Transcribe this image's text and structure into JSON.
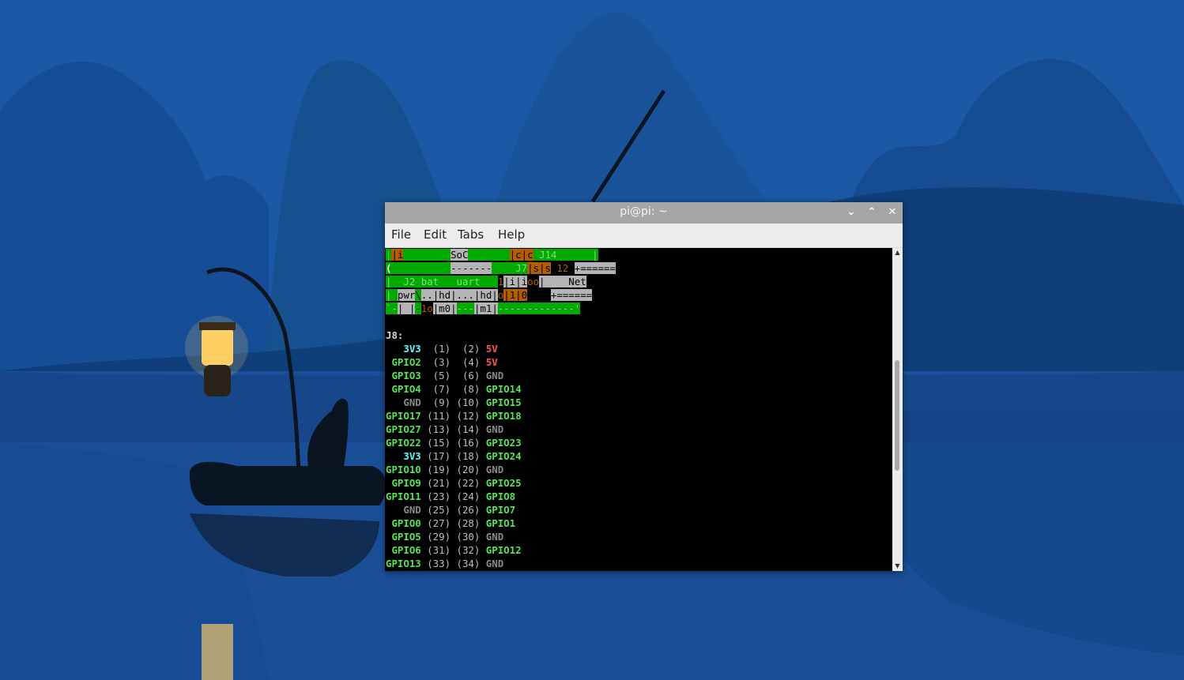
{
  "window": {
    "title": "pi@pi: ~",
    "buttons": {
      "minimize": "⌄",
      "maximize": "⌃",
      "close": "✕"
    }
  },
  "menu": {
    "file": "File",
    "edit": "Edit",
    "tabs": "Tabs",
    "help": "Help"
  },
  "board_art": {
    "line1": [
      "|",
      "|i",
      "        ",
      "SoC",
      "       ",
      "|c|c",
      " J14      |"
    ],
    "line2": [
      "(",
      "          ",
      "-------",
      "    J7",
      "|s|s",
      " 12 ",
      "+======"
    ],
    "line3": [
      "|  J2 bat   uart   ",
      "1",
      "|i|i",
      "oo",
      "|    Net"
    ],
    "line4": [
      "| ",
      "pwr",
      "\\",
      "..|hd|...|hd|",
      "o",
      "|1|0",
      "    ",
      "+======"
    ],
    "line5": [
      "`-",
      "| |",
      "-",
      "1o",
      "|m0|",
      "---",
      "|m1|",
      "-------------'"
    ]
  },
  "header_label": "J8:",
  "pins": [
    {
      "left": "3V3",
      "left_type": "3v3",
      "a": "(1)",
      "b": "(2)",
      "right": "5V",
      "right_type": "5v"
    },
    {
      "left": "GPIO2",
      "left_type": "gpio",
      "a": "(3)",
      "b": "(4)",
      "right": "5V",
      "right_type": "5v"
    },
    {
      "left": "GPIO3",
      "left_type": "gpio",
      "a": "(5)",
      "b": "(6)",
      "right": "GND",
      "right_type": "gnd"
    },
    {
      "left": "GPIO4",
      "left_type": "gpio",
      "a": "(7)",
      "b": "(8)",
      "right": "GPIO14",
      "right_type": "gpio"
    },
    {
      "left": "GND",
      "left_type": "gnd",
      "a": "(9)",
      "b": "(10)",
      "right": "GPIO15",
      "right_type": "gpio"
    },
    {
      "left": "GPIO17",
      "left_type": "gpio",
      "a": "(11)",
      "b": "(12)",
      "right": "GPIO18",
      "right_type": "gpio"
    },
    {
      "left": "GPIO27",
      "left_type": "gpio",
      "a": "(13)",
      "b": "(14)",
      "right": "GND",
      "right_type": "gnd"
    },
    {
      "left": "GPIO22",
      "left_type": "gpio",
      "a": "(15)",
      "b": "(16)",
      "right": "GPIO23",
      "right_type": "gpio"
    },
    {
      "left": "3V3",
      "left_type": "3v3",
      "a": "(17)",
      "b": "(18)",
      "right": "GPIO24",
      "right_type": "gpio"
    },
    {
      "left": "GPIO10",
      "left_type": "gpio",
      "a": "(19)",
      "b": "(20)",
      "right": "GND",
      "right_type": "gnd"
    },
    {
      "left": "GPIO9",
      "left_type": "gpio",
      "a": "(21)",
      "b": "(22)",
      "right": "GPIO25",
      "right_type": "gpio"
    },
    {
      "left": "GPIO11",
      "left_type": "gpio",
      "a": "(23)",
      "b": "(24)",
      "right": "GPIO8",
      "right_type": "gpio"
    },
    {
      "left": "GND",
      "left_type": "gnd",
      "a": "(25)",
      "b": "(26)",
      "right": "GPIO7",
      "right_type": "gpio"
    },
    {
      "left": "GPIO0",
      "left_type": "gpio",
      "a": "(27)",
      "b": "(28)",
      "right": "GPIO1",
      "right_type": "gpio"
    },
    {
      "left": "GPIO5",
      "left_type": "gpio",
      "a": "(29)",
      "b": "(30)",
      "right": "GND",
      "right_type": "gnd"
    },
    {
      "left": "GPIO6",
      "left_type": "gpio",
      "a": "(31)",
      "b": "(32)",
      "right": "GPIO12",
      "right_type": "gpio"
    },
    {
      "left": "GPIO13",
      "left_type": "gpio",
      "a": "(33)",
      "b": "(34)",
      "right": "GND",
      "right_type": "gnd"
    }
  ],
  "scrollbar": {
    "up_arrow": "▲",
    "down_arrow": "▼"
  },
  "colors": {
    "gpio": "#55e655",
    "power_5v": "#ff5555",
    "power_3v3": "#55ffff",
    "ground": "#8a8a8a",
    "terminal_bg": "#000000",
    "titlebar": "#a6a6a6",
    "menubar": "#ececec"
  }
}
